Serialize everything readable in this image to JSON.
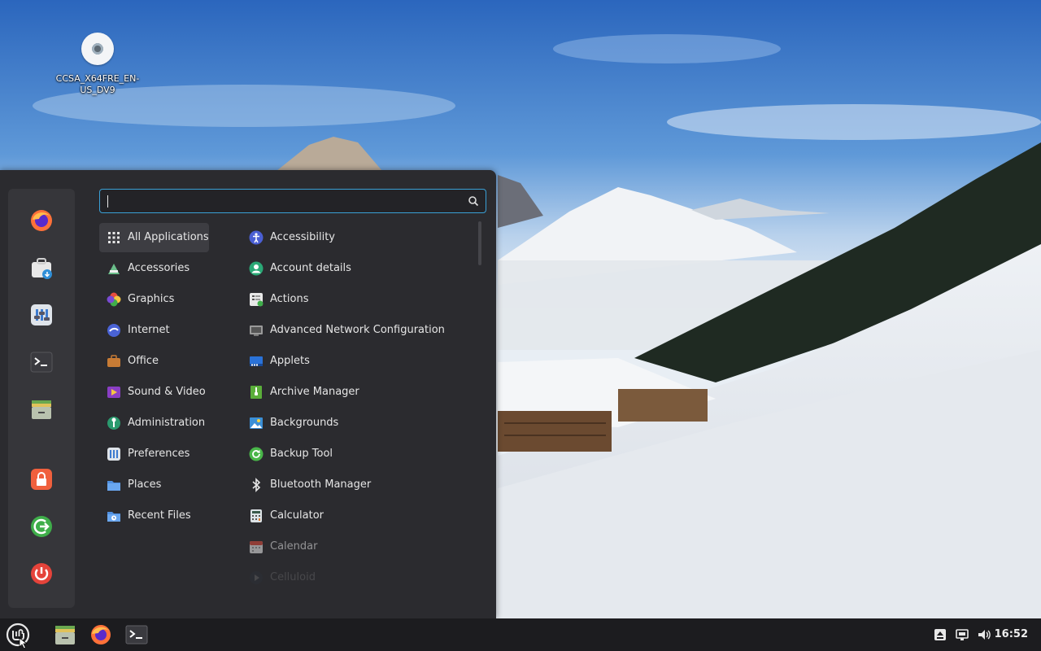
{
  "desktop": {
    "icon_label": "CCSA_X64FRE_EN-US_DV9",
    "icon_name": "optical-disc-icon"
  },
  "menu": {
    "search": {
      "value": "",
      "placeholder": ""
    },
    "favorites": [
      {
        "name": "firefox-icon",
        "color": "#ff7139"
      },
      {
        "name": "software-manager-icon",
        "color": "#e8e8e8"
      },
      {
        "name": "system-settings-icon",
        "color": "#dfe4ea"
      },
      {
        "name": "terminal-icon",
        "color": "#3a3a3f"
      },
      {
        "name": "files-icon",
        "color": "#c6d0a0"
      }
    ],
    "session": [
      {
        "name": "lock-screen-icon",
        "color": "#f0603d"
      },
      {
        "name": "logout-icon",
        "color": "#3fae4a"
      },
      {
        "name": "shutdown-icon",
        "color": "#e5433a"
      }
    ],
    "categories": [
      {
        "label": "All Applications",
        "icon": "grid-icon"
      },
      {
        "label": "Accessories",
        "icon": "accessories-icon"
      },
      {
        "label": "Graphics",
        "icon": "graphics-icon"
      },
      {
        "label": "Internet",
        "icon": "internet-icon"
      },
      {
        "label": "Office",
        "icon": "office-icon"
      },
      {
        "label": "Sound & Video",
        "icon": "sound-video-icon"
      },
      {
        "label": "Administration",
        "icon": "administration-icon"
      },
      {
        "label": "Preferences",
        "icon": "preferences-icon"
      },
      {
        "label": "Places",
        "icon": "folder-icon"
      },
      {
        "label": "Recent Files",
        "icon": "recent-files-icon"
      }
    ],
    "selected_category": "All Applications",
    "apps": [
      {
        "label": "Accessibility",
        "icon": "accessibility-icon",
        "color": "#4a5fd4"
      },
      {
        "label": "Account details",
        "icon": "account-icon",
        "color": "#2aa876"
      },
      {
        "label": "Actions",
        "icon": "actions-icon",
        "color": "#e8e8e8"
      },
      {
        "label": "Advanced Network Configuration",
        "icon": "network-icon",
        "color": "#9a9a9a"
      },
      {
        "label": "Applets",
        "icon": "applets-icon",
        "color": "#2a72d8"
      },
      {
        "label": "Archive Manager",
        "icon": "archive-icon",
        "color": "#5aae3a"
      },
      {
        "label": "Backgrounds",
        "icon": "backgrounds-icon",
        "color": "#3b8fd6"
      },
      {
        "label": "Backup Tool",
        "icon": "backup-icon",
        "color": "#49b649"
      },
      {
        "label": "Bluetooth Manager",
        "icon": "bluetooth-icon",
        "color": "#e6e6e6"
      },
      {
        "label": "Calculator",
        "icon": "calculator-icon",
        "color": "#dde3e6"
      },
      {
        "label": "Calendar",
        "icon": "calendar-icon",
        "color": "#e24c3f"
      },
      {
        "label": "Celluloid",
        "icon": "celluloid-icon",
        "color": "#2b3a4a"
      }
    ]
  },
  "panel": {
    "menu_button": "linux-mint-menu-icon",
    "launchers": [
      "files-icon",
      "firefox-icon",
      "terminal-icon"
    ],
    "tray": [
      "updates-icon",
      "network-icon",
      "volume-icon"
    ],
    "clock": "16:52"
  }
}
